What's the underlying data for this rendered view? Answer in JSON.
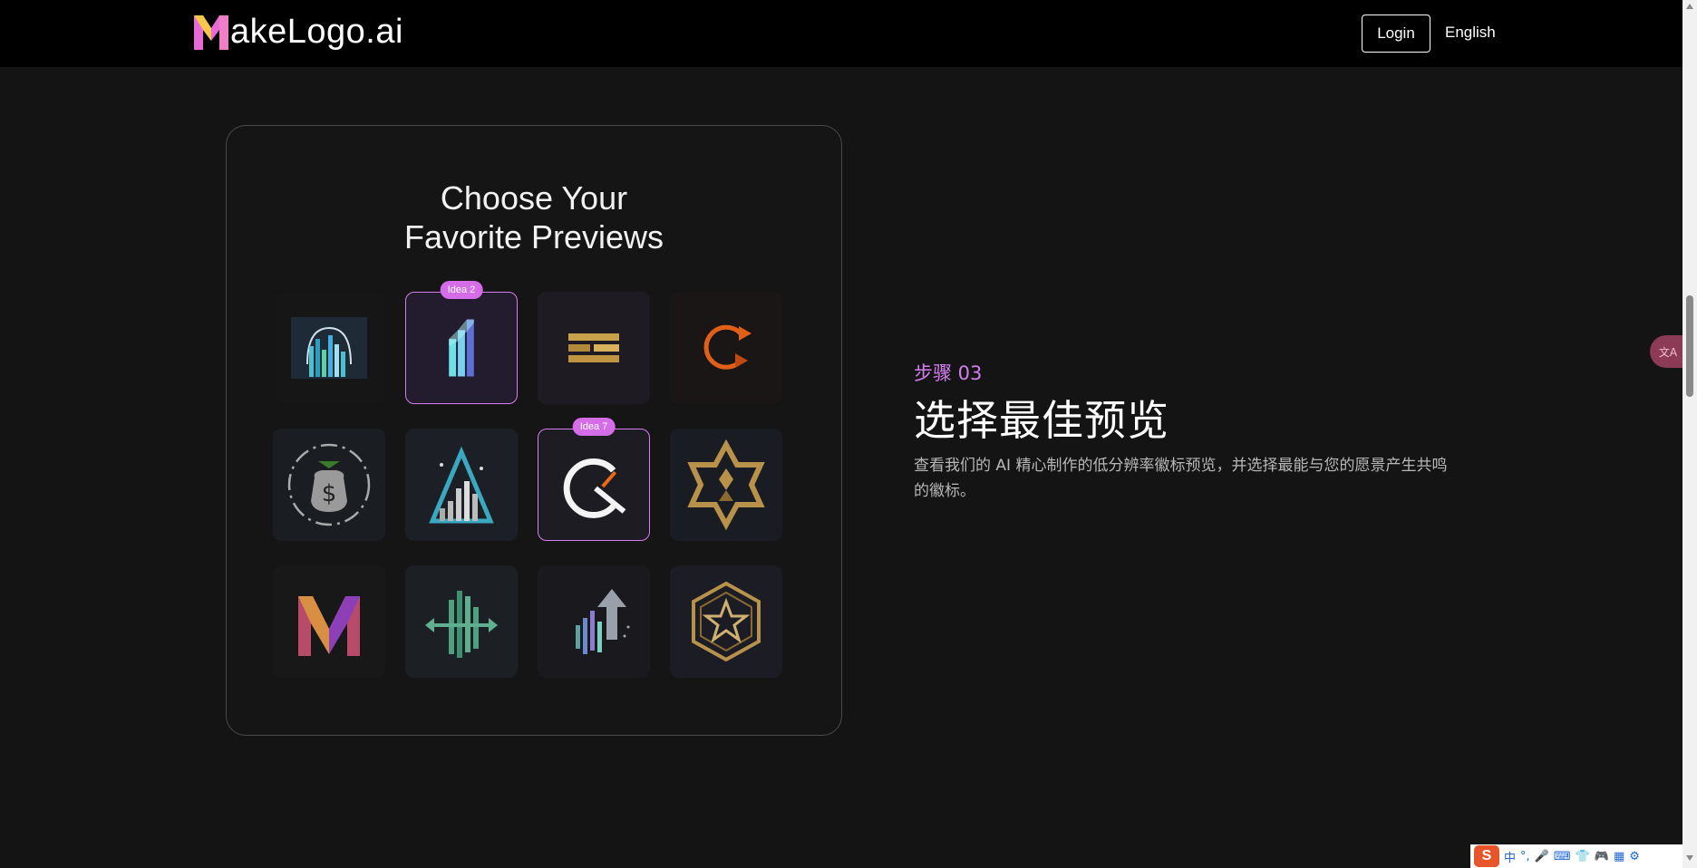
{
  "header": {
    "brand_initial": "M",
    "brand_rest": "akeLogo.ai",
    "login_label": "Login",
    "language_label": "English"
  },
  "card": {
    "title_line1": "Choose Your",
    "title_line2": "Favorite Previews",
    "tiles": [
      {
        "icon": "city-skyline-arch-logo",
        "selected": false
      },
      {
        "icon": "bar-chart-logo",
        "selected": true,
        "badge": "Idea 2"
      },
      {
        "icon": "gold-bricks-logo",
        "selected": false
      },
      {
        "icon": "orange-refresh-logo",
        "selected": false
      },
      {
        "icon": "money-bag-logo",
        "selected": false
      },
      {
        "icon": "rising-triangle-bars-logo",
        "selected": false
      },
      {
        "icon": "q-gauge-logo",
        "selected": true,
        "badge": "Idea 7"
      },
      {
        "icon": "gold-star-emblem-logo",
        "selected": false
      },
      {
        "icon": "colorful-m-logo",
        "selected": false
      },
      {
        "icon": "teal-bars-arrows-logo",
        "selected": false
      },
      {
        "icon": "arrow-up-bars-logo",
        "selected": false
      },
      {
        "icon": "star-hexagon-logo",
        "selected": false
      }
    ]
  },
  "step": {
    "label": "步骤 03",
    "title": "选择最佳预览",
    "description": "查看我们的 AI 精心制作的低分辨率徽标预览，并选择最能与您的愿景产生共鸣的徽标。"
  },
  "ime": {
    "logo": "S",
    "mode": "中",
    "punct": "°,"
  },
  "colors": {
    "accent": "#d47ef0",
    "badge": "#d56ce8",
    "background": "#141414",
    "header": "#000000"
  }
}
